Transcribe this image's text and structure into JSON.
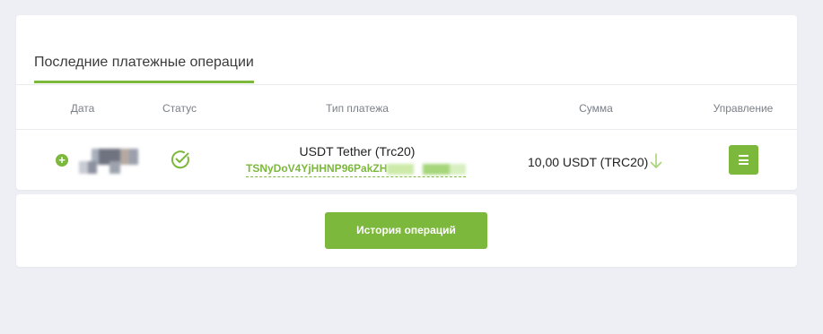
{
  "tabs": {
    "active_label": "Последние платежные операции"
  },
  "table": {
    "headers": {
      "date": "Дата",
      "status": "Статус",
      "type": "Тип платежа",
      "amount": "Сумма",
      "manage": "Управление"
    },
    "rows": [
      {
        "date": "[redacted]",
        "status_icon": "check-circle-icon",
        "type": "USDT Tether (Trc20)",
        "address": "TSNyDoV4YjHHNP96PakZH",
        "amount": "10,00 USDT (TRC20)",
        "direction_icon": "arrow-down-icon"
      }
    ]
  },
  "footer": {
    "history_button": "История операций"
  },
  "colors": {
    "accent": "#7cb83b",
    "background": "#eeeff4",
    "card": "#ffffff"
  }
}
